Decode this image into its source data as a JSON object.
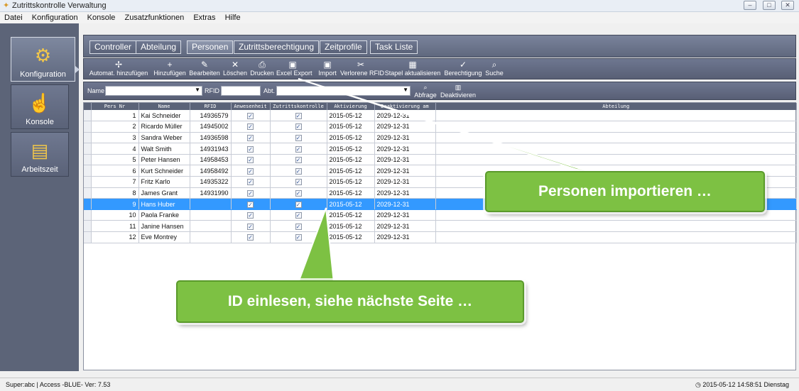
{
  "window": {
    "title": "Zutrittskontrolle Verwaltung",
    "min_icon": "minimize-icon",
    "max_icon": "maximize-icon",
    "close_icon": "close-icon"
  },
  "menu": [
    "Datei",
    "Konfiguration",
    "Konsole",
    "Zusatzfunktionen",
    "Extras",
    "Hilfe"
  ],
  "nav": [
    {
      "label": "Konfiguration",
      "icon": "gear-icon",
      "active": true
    },
    {
      "label": "Konsole",
      "icon": "hand-pointer-icon",
      "active": false
    },
    {
      "label": "Arbeitszeit",
      "icon": "timecard-icon",
      "active": false
    }
  ],
  "tabs": [
    "Controller",
    "Abteilung",
    "Personen",
    "Zutrittsberechtigung",
    "Zeitprofile",
    "Task Liste"
  ],
  "active_tab": "Personen",
  "toolbar": [
    {
      "label": "Automat. hinzufügen",
      "icon": "auto-add-icon"
    },
    {
      "label": "Hinzufügen",
      "icon": "plus-icon"
    },
    {
      "label": "Bearbeiten",
      "icon": "pencil-icon"
    },
    {
      "label": "Löschen",
      "icon": "delete-x-icon"
    },
    {
      "label": "Drucken",
      "icon": "printer-icon"
    },
    {
      "label": "Excel Export",
      "icon": "excel-export-icon"
    },
    {
      "label": "Import",
      "icon": "import-icon"
    },
    {
      "label": "Verlorene RFID",
      "icon": "lost-rfid-icon"
    },
    {
      "label": "Stapel aktualisieren",
      "icon": "batch-update-icon"
    },
    {
      "label": "Berechtigung",
      "icon": "permission-icon"
    },
    {
      "label": "Suche",
      "icon": "search-icon"
    }
  ],
  "filter": {
    "name_label": "Name",
    "rfid_label": "RFID",
    "abt_label": "Abt.",
    "query_label": "Abfrage",
    "deactivate_label": "Deaktivieren"
  },
  "table": {
    "columns": [
      "Pers Nr",
      "Name",
      "RFID",
      "Anwesenheit",
      "Zutrittskontrolle",
      "Aktivierung",
      "Deaktivierung am",
      "Abteilung"
    ],
    "rows": [
      {
        "nr": "1",
        "name": "Kai Schneider",
        "rfid": "14936579",
        "anw": true,
        "zut": true,
        "akt": "2015-05-12",
        "deakt": "2029-12-31",
        "abt": ""
      },
      {
        "nr": "2",
        "name": "Ricardo Müller",
        "rfid": "14945002",
        "anw": true,
        "zut": true,
        "akt": "2015-05-12",
        "deakt": "2029-12-31",
        "abt": ""
      },
      {
        "nr": "3",
        "name": "Sandra Weber",
        "rfid": "14936598",
        "anw": true,
        "zut": true,
        "akt": "2015-05-12",
        "deakt": "2029-12-31",
        "abt": ""
      },
      {
        "nr": "4",
        "name": "Walt Smith",
        "rfid": "14931943",
        "anw": true,
        "zut": true,
        "akt": "2015-05-12",
        "deakt": "2029-12-31",
        "abt": ""
      },
      {
        "nr": "5",
        "name": "Peter Hansen",
        "rfid": "14958453",
        "anw": true,
        "zut": true,
        "akt": "2015-05-12",
        "deakt": "2029-12-31",
        "abt": ""
      },
      {
        "nr": "6",
        "name": "Kurt Schneider",
        "rfid": "14958492",
        "anw": true,
        "zut": true,
        "akt": "2015-05-12",
        "deakt": "2029-12-31",
        "abt": ""
      },
      {
        "nr": "7",
        "name": "Fritz Karlo",
        "rfid": "14935322",
        "anw": true,
        "zut": true,
        "akt": "2015-05-12",
        "deakt": "2029-12-31",
        "abt": ""
      },
      {
        "nr": "8",
        "name": "James Grant",
        "rfid": "14931990",
        "anw": true,
        "zut": true,
        "akt": "2015-05-12",
        "deakt": "2029-12-31",
        "abt": ""
      },
      {
        "nr": "9",
        "name": "Hans Huber",
        "rfid": "",
        "anw": true,
        "zut": true,
        "akt": "2015-05-12",
        "deakt": "2029-12-31",
        "abt": "",
        "selected": true
      },
      {
        "nr": "10",
        "name": "Paola Franke",
        "rfid": "",
        "anw": true,
        "zut": true,
        "akt": "2015-05-12",
        "deakt": "2029-12-31",
        "abt": ""
      },
      {
        "nr": "11",
        "name": "Janine Hansen",
        "rfid": "",
        "anw": true,
        "zut": true,
        "akt": "2015-05-12",
        "deakt": "2029-12-31",
        "abt": ""
      },
      {
        "nr": "12",
        "name": "Eve Montrey",
        "rfid": "",
        "anw": true,
        "zut": true,
        "akt": "2015-05-12",
        "deakt": "2029-12-31",
        "abt": ""
      }
    ]
  },
  "status": {
    "left": "Super:abc | Access -BLUE- Ver: 7.53",
    "right": "2015-05-12 14:58:51 Dienstag",
    "clock_icon": "clock-icon"
  },
  "callouts": {
    "import": "Personen importieren …",
    "rfid": "ID einlesen, siehe nächste Seite …"
  },
  "colors": {
    "nav_bg": "#5c6478",
    "selection": "#3399ff",
    "callout_green": "#7dc143"
  }
}
